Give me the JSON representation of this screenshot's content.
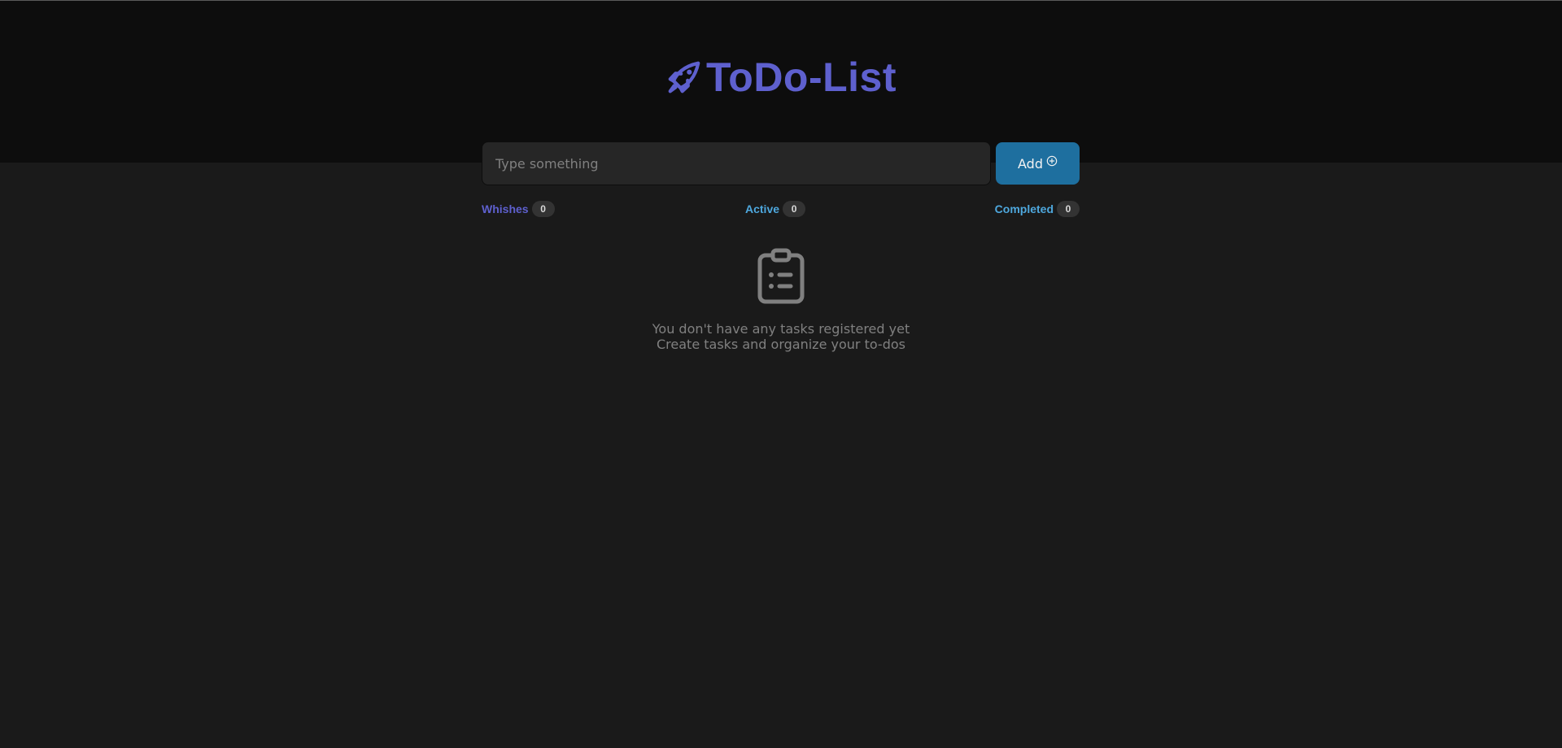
{
  "header": {
    "title": "ToDo-List",
    "logo_icon": "rocket-icon",
    "brand_color": "#5e60ce"
  },
  "form": {
    "input": {
      "value": "",
      "placeholder": "Type something"
    },
    "add_label": "Add",
    "add_icon": "plus-circle-icon",
    "button_color": "#1e6f9f"
  },
  "counters": [
    {
      "label": "Whishes",
      "count": "0",
      "color": "#5e60ce"
    },
    {
      "label": "Active",
      "count": "0",
      "color": "#4ea8de"
    },
    {
      "label": "Completed",
      "count": "0",
      "color": "#4ea8de"
    }
  ],
  "empty_state": {
    "icon": "clipboard-icon",
    "line1": "You don't have any tasks registered yet",
    "line2": "Create tasks and organize your to-dos"
  }
}
